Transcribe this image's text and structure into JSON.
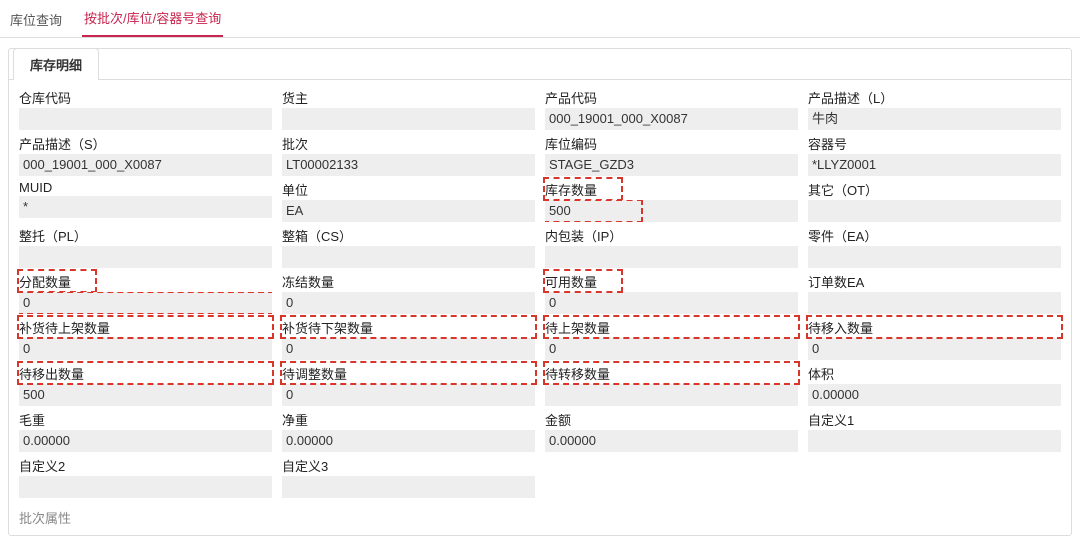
{
  "topTabs": {
    "t1": "库位查询",
    "t2": "按批次/库位/容器号查询"
  },
  "subTabs": {
    "s1": "库存明细"
  },
  "fields": {
    "r1c1": {
      "label": "仓库代码",
      "value": ""
    },
    "r1c2": {
      "label": "货主",
      "value": ""
    },
    "r1c3": {
      "label": "产品代码",
      "value": "000_19001_000_X0087"
    },
    "r1c4": {
      "label": "产品描述（L）",
      "value": "牛肉"
    },
    "r2c1": {
      "label": "产品描述（S）",
      "value": "000_19001_000_X0087"
    },
    "r2c2": {
      "label": "批次",
      "value": "LT00002133"
    },
    "r2c3": {
      "label": "库位编码",
      "value": "STAGE_GZD3"
    },
    "r2c4": {
      "label": "容器号",
      "value": "*LLYZ0001"
    },
    "r3c1": {
      "label": "MUID",
      "value": "*"
    },
    "r3c2": {
      "label": "单位",
      "value": "EA"
    },
    "r3c3": {
      "label": "库存数量",
      "value": "500"
    },
    "r3c4": {
      "label": "其它（OT）",
      "value": ""
    },
    "r4c1": {
      "label": "整托（PL）",
      "value": ""
    },
    "r4c2": {
      "label": "整箱（CS）",
      "value": ""
    },
    "r4c3": {
      "label": "内包装（IP）",
      "value": ""
    },
    "r4c4": {
      "label": "零件（EA）",
      "value": ""
    },
    "r5c1": {
      "label": "分配数量",
      "value": "0"
    },
    "r5c2": {
      "label": "冻结数量",
      "value": "0"
    },
    "r5c3": {
      "label": "可用数量",
      "value": "0"
    },
    "r5c4": {
      "label": "订单数EA",
      "value": ""
    },
    "r6c1": {
      "label": "补货待上架数量",
      "value": "0"
    },
    "r6c2": {
      "label": "补货待下架数量",
      "value": "0"
    },
    "r6c3": {
      "label": "待上架数量",
      "value": "0"
    },
    "r6c4": {
      "label": "待移入数量",
      "value": "0"
    },
    "r7c1": {
      "label": "待移出数量",
      "value": "500"
    },
    "r7c2": {
      "label": "待调整数量",
      "value": "0"
    },
    "r7c3": {
      "label": "待转移数量",
      "value": ""
    },
    "r7c4": {
      "label": "体积",
      "value": "0.00000"
    },
    "r8c1": {
      "label": "毛重",
      "value": "0.00000"
    },
    "r8c2": {
      "label": "净重",
      "value": "0.00000"
    },
    "r8c3": {
      "label": "金额",
      "value": "0.00000"
    },
    "r8c4": {
      "label": "自定义1",
      "value": ""
    },
    "r9c1": {
      "label": "自定义2",
      "value": ""
    },
    "r9c2": {
      "label": "自定义3",
      "value": ""
    }
  },
  "section2": "批次属性"
}
